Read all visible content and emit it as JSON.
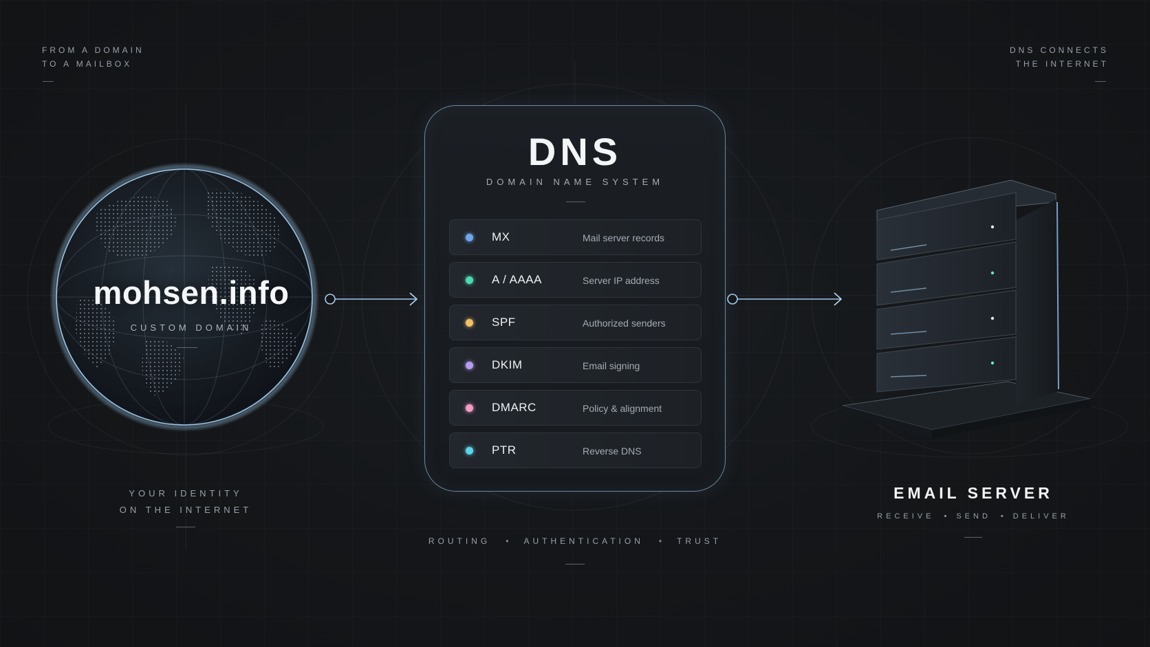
{
  "corner_left": {
    "line1": "FROM A DOMAIN",
    "line2": "TO A MAILBOX"
  },
  "corner_right": {
    "line1": "DNS CONNECTS",
    "line2": "THE INTERNET"
  },
  "domain": {
    "name": "mohsen.info",
    "label": "CUSTOM DOMAIN"
  },
  "identity": {
    "line1": "YOUR IDENTITY",
    "line2": "ON THE INTERNET"
  },
  "dns": {
    "title": "DNS",
    "subtitle": "DOMAIN NAME SYSTEM",
    "records": [
      {
        "type": "MX",
        "description": "Mail server records",
        "color": "#6fa7e8"
      },
      {
        "type": "A / AAAA",
        "description": "Server IP address",
        "color": "#4fd6b3"
      },
      {
        "type": "SPF",
        "description": "Authorized senders",
        "color": "#f2c06b"
      },
      {
        "type": "DKIM",
        "description": "Email signing",
        "color": "#b79bf0"
      },
      {
        "type": "DMARC",
        "description": "Policy & alignment",
        "color": "#f09cc4"
      },
      {
        "type": "PTR",
        "description": "Reverse DNS",
        "color": "#5fd3ea"
      }
    ],
    "tags": [
      "ROUTING",
      "AUTHENTICATION",
      "TRUST"
    ],
    "tag_separator": "•"
  },
  "server": {
    "title": "EMAIL SERVER",
    "actions": [
      "RECEIVE",
      "SEND",
      "DELIVER"
    ],
    "action_separator": "•"
  },
  "colors": {
    "background": "#131518",
    "accent": "#8ec2ef",
    "card_border": "#6b8aa3"
  }
}
